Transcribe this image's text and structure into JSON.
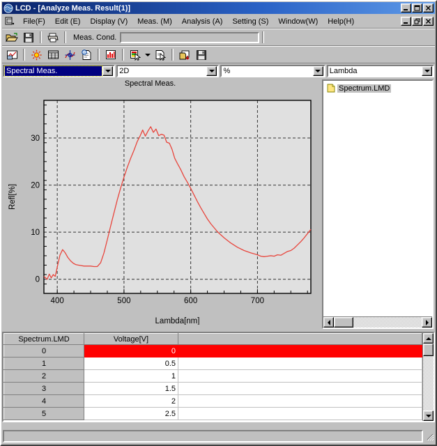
{
  "window": {
    "title": "LCD - [Analyze Meas. Result(1)]",
    "app_icon": "lcd-app-icon",
    "controls": {
      "minimize": "_",
      "maximize": "□",
      "close": "×"
    },
    "mdi_controls": {
      "minimize": "_",
      "restore": "❐",
      "close": "×"
    }
  },
  "menubar": {
    "doc_icon": "document-icon",
    "items": [
      {
        "label": "File(F)",
        "name": "menu-file"
      },
      {
        "label": "Edit (E)",
        "name": "menu-edit"
      },
      {
        "label": "Display (V)",
        "name": "menu-display"
      },
      {
        "label": "Meas. (M)",
        "name": "menu-meas"
      },
      {
        "label": "Analysis (A)",
        "name": "menu-analysis"
      },
      {
        "label": "Setting (S)",
        "name": "menu-setting"
      },
      {
        "label": "Window(W)",
        "name": "menu-window"
      },
      {
        "label": "Help(H)",
        "name": "menu-help"
      }
    ]
  },
  "toolbar1": {
    "buttons": [
      {
        "name": "open-file-icon"
      },
      {
        "name": "save-file-icon"
      },
      {
        "name": "print-icon"
      }
    ],
    "meas_cond_label": "Meas. Cond.",
    "meas_cond_value": "",
    "meas_cond_placeholder": ""
  },
  "toolbar2": {
    "buttons": [
      {
        "name": "view-graph-icon"
      },
      {
        "name": "light-source-icon"
      },
      {
        "name": "data-table-icon"
      },
      {
        "name": "crosshair-marker-icon"
      },
      {
        "name": "info-properties-icon"
      },
      {
        "name": "bar-chart-icon"
      },
      {
        "name": "color-select-icon"
      },
      {
        "name": "dropdown-arrow-icon"
      },
      {
        "name": "copy-page-icon"
      },
      {
        "name": "export-data-icon"
      },
      {
        "name": "save-data-icon"
      }
    ]
  },
  "combos": {
    "measurement_mode": {
      "value": "Spectral Meas.",
      "focused": true
    },
    "view_mode": {
      "value": "2D"
    },
    "unit": {
      "value": "%"
    },
    "axis": {
      "value": "Lambda"
    }
  },
  "tree": {
    "items": [
      {
        "label": "Spectrum.LMD",
        "icon": "file-document-icon",
        "selected": true
      }
    ],
    "hscroll": {
      "left_arrow": "◄",
      "right_arrow": "►"
    }
  },
  "table": {
    "columns": [
      "Spectrum.LMD",
      "Voltage[V]",
      ""
    ],
    "rows": [
      {
        "index": "0",
        "voltage": "0",
        "selected": true
      },
      {
        "index": "1",
        "voltage": "0.5",
        "selected": false
      },
      {
        "index": "2",
        "voltage": "1",
        "selected": false
      },
      {
        "index": "3",
        "voltage": "1.5",
        "selected": false
      },
      {
        "index": "4",
        "voltage": "2",
        "selected": false
      },
      {
        "index": "5",
        "voltage": "2.5",
        "selected": false
      }
    ],
    "selection_color": "#ff0000",
    "vscroll": {
      "up_arrow": "▲",
      "down_arrow": "▼"
    }
  },
  "statusbar": {
    "text": ""
  },
  "chart_data": {
    "type": "line",
    "title": "Spectral Meas.",
    "xlabel": "Lambda[nm]",
    "ylabel": "Refl[%]",
    "xlim": [
      380,
      780
    ],
    "ylim": [
      -3,
      38
    ],
    "xticks": [
      400,
      500,
      600,
      700
    ],
    "yticks": [
      0,
      10,
      20,
      30
    ],
    "grid": true,
    "legend": null,
    "series": [
      {
        "name": "Spectrum.LMD",
        "color": "#e8453c",
        "x": [
          380,
          385,
          388,
          391,
          394,
          397,
          400,
          404,
          408,
          412,
          416,
          420,
          424,
          428,
          432,
          436,
          440,
          445,
          450,
          455,
          460,
          465,
          470,
          475,
          480,
          485,
          490,
          495,
          500,
          505,
          510,
          515,
          520,
          524,
          528,
          532,
          536,
          540,
          544,
          548,
          552,
          556,
          560,
          564,
          568,
          572,
          576,
          580,
          585,
          590,
          595,
          600,
          605,
          610,
          615,
          620,
          625,
          630,
          640,
          650,
          660,
          670,
          680,
          690,
          700,
          705,
          710,
          715,
          720,
          725,
          730,
          735,
          740,
          745,
          750,
          755,
          760,
          765,
          770,
          775,
          780
        ],
        "y": [
          0.6,
          0.0,
          1.1,
          0.3,
          1.0,
          0.6,
          2.6,
          5.1,
          6.3,
          5.6,
          4.6,
          3.9,
          3.4,
          3.1,
          3.0,
          2.9,
          2.8,
          2.8,
          2.8,
          2.7,
          2.7,
          3.5,
          5.6,
          8.4,
          11.3,
          14.1,
          16.9,
          19.4,
          21.7,
          23.8,
          25.7,
          27.4,
          29.3,
          30.4,
          31.7,
          30.4,
          31.5,
          32.4,
          31.2,
          31.9,
          30.5,
          30.8,
          30.6,
          29.1,
          28.9,
          27.6,
          25.7,
          24.6,
          23.3,
          21.8,
          20.6,
          19.3,
          17.9,
          16.5,
          15.2,
          14.0,
          12.8,
          11.8,
          10.1,
          8.8,
          7.7,
          6.8,
          6.1,
          5.6,
          5.2,
          4.9,
          4.8,
          4.9,
          5.0,
          4.9,
          5.2,
          5.1,
          5.5,
          5.9,
          6.1,
          6.6,
          7.3,
          8.0,
          8.8,
          9.7,
          10.6
        ]
      }
    ]
  }
}
